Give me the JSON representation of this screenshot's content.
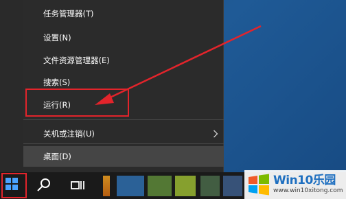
{
  "context_menu": {
    "items": [
      {
        "label": "任务管理器(T)"
      },
      {
        "label": "设置(N)"
      },
      {
        "label": "文件资源管理器(E)"
      },
      {
        "label": "搜索(S)"
      },
      {
        "label": "运行(R)"
      },
      {
        "label": "关机或注销(U)"
      },
      {
        "label": "桌面(D)"
      }
    ]
  },
  "annotations": {
    "highlight_color": "#e3242b"
  },
  "taskbar": {
    "icons": [
      "windows-start-icon",
      "search-icon",
      "task-view-icon"
    ]
  },
  "watermark": {
    "brand": "Win10乐园",
    "url": "www.win10xitong.com"
  }
}
